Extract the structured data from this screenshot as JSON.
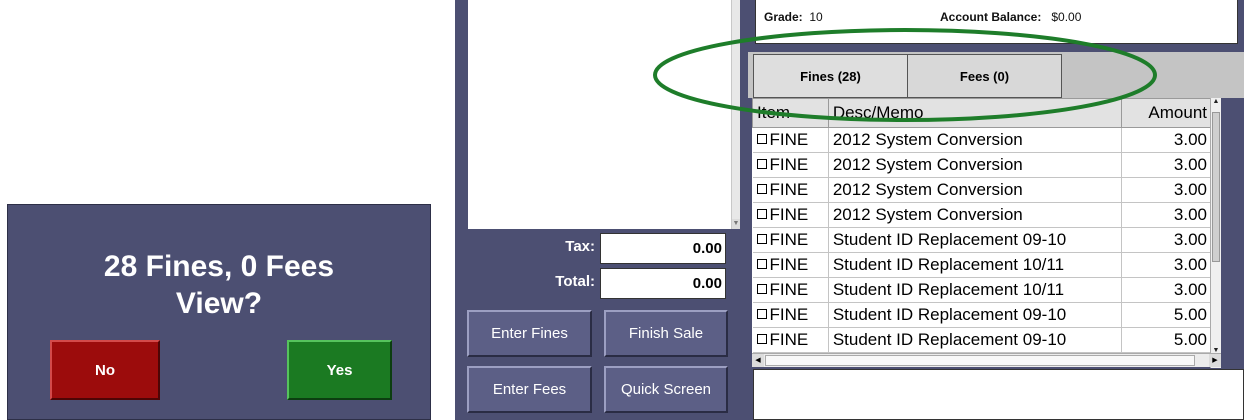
{
  "dialog": {
    "line1": "28 Fines, 0 Fees",
    "line2": "View?",
    "no_label": "No",
    "yes_label": "Yes"
  },
  "summary": {
    "tax_label": "Tax:",
    "tax_value": "0.00",
    "total_label": "Total:",
    "total_value": "0.00"
  },
  "actions": {
    "enter_fines": "Enter Fines",
    "finish_sale": "Finish Sale",
    "enter_fees": "Enter Fees",
    "quick_screen": "Quick Screen"
  },
  "info": {
    "grade_label": "Grade:",
    "grade_value": "10",
    "balance_label": "Account Balance:",
    "balance_value": "$0.00"
  },
  "tabs": {
    "fines": "Fines (28)",
    "fees": "Fees (0)"
  },
  "table": {
    "headers": [
      "Item",
      "Desc/Memo",
      "Amount"
    ],
    "rows": [
      {
        "item": "FINE",
        "desc": "2012 System Conversion",
        "amount": "3.00"
      },
      {
        "item": "FINE",
        "desc": "2012 System Conversion",
        "amount": "3.00"
      },
      {
        "item": "FINE",
        "desc": "2012 System Conversion",
        "amount": "3.00"
      },
      {
        "item": "FINE",
        "desc": "2012 System Conversion",
        "amount": "3.00"
      },
      {
        "item": "FINE",
        "desc": "Student ID Replacement 09-10",
        "amount": "3.00"
      },
      {
        "item": "FINE",
        "desc": "Student ID Replacement 10/11",
        "amount": "3.00"
      },
      {
        "item": "FINE",
        "desc": "Student ID Replacement 10/11",
        "amount": "3.00"
      },
      {
        "item": "FINE",
        "desc": "Student ID Replacement 09-10",
        "amount": "5.00"
      },
      {
        "item": "FINE",
        "desc": "Student ID Replacement 09-10",
        "amount": "5.00"
      }
    ]
  },
  "colors": {
    "panel": "#4c4f72",
    "no_button": "#9c0c0c",
    "yes_button": "#1b7a22",
    "highlight_ellipse": "#1e7d2a"
  }
}
